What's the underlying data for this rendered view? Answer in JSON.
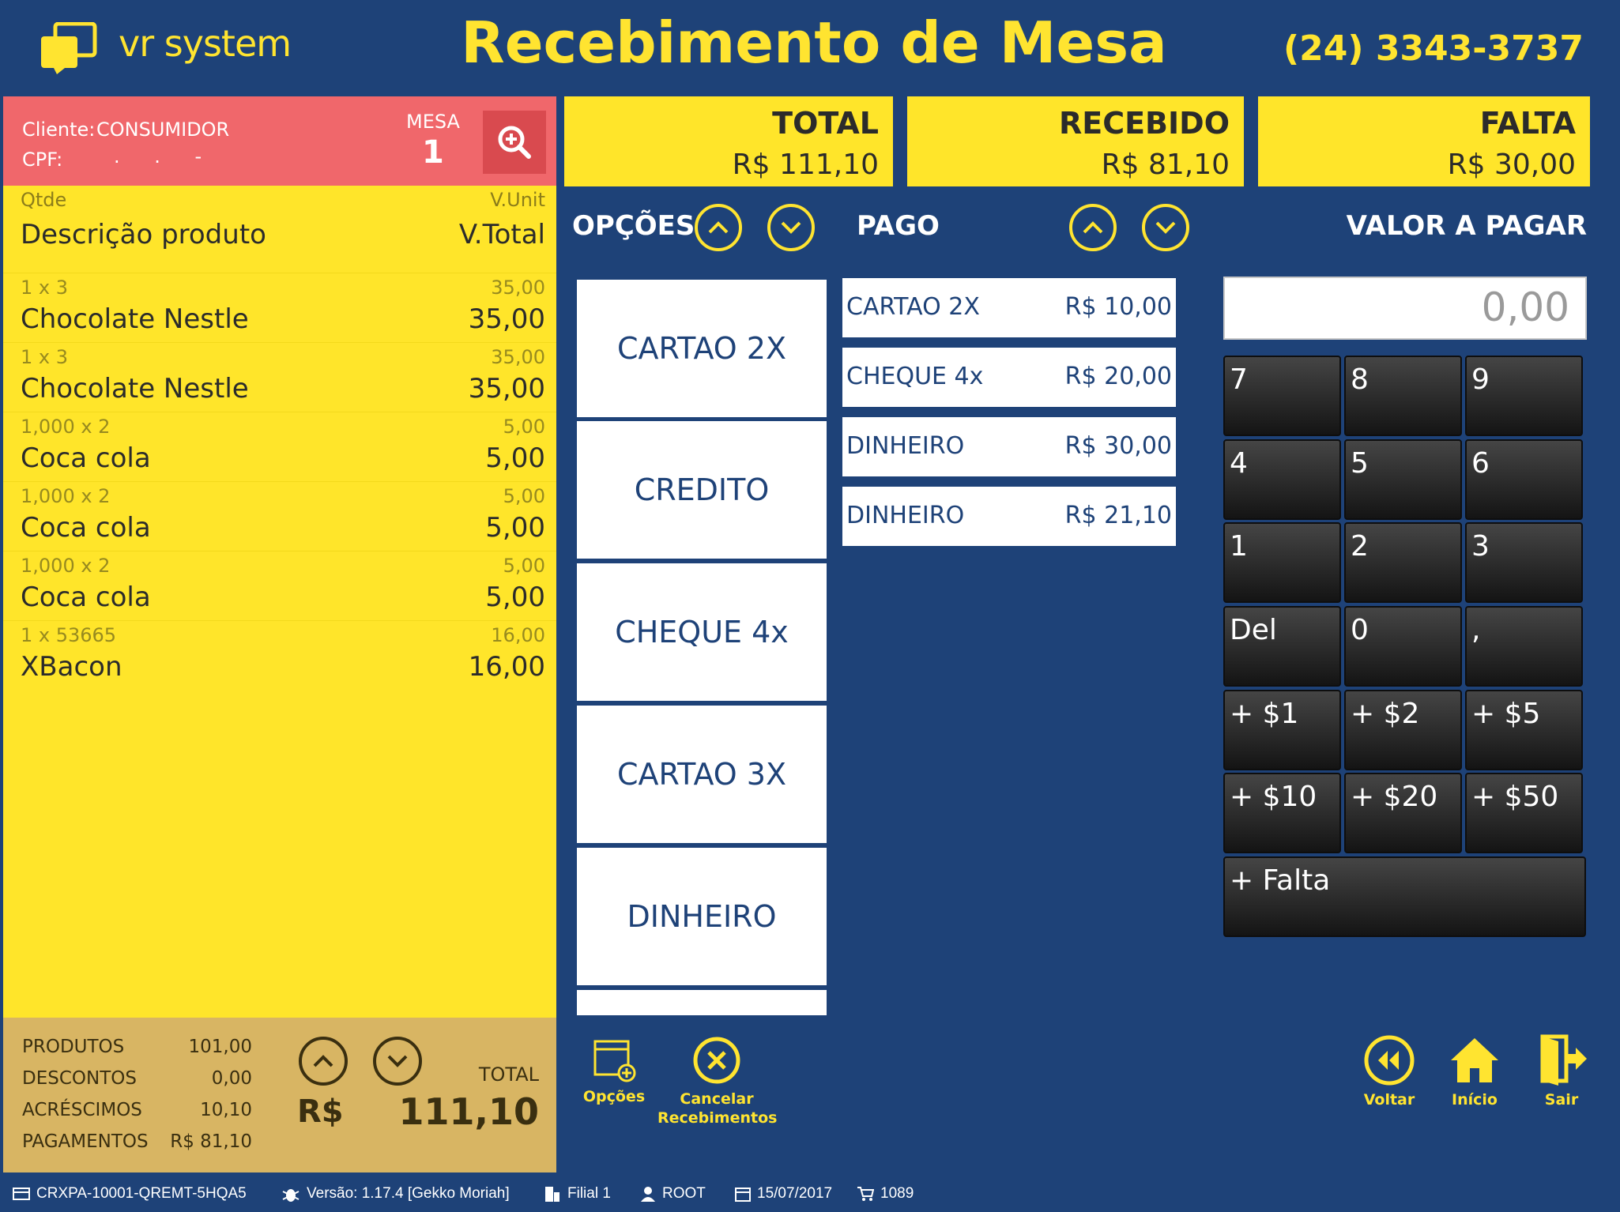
{
  "header": {
    "brand": "vr system",
    "title": "Recebimento de Mesa",
    "phone": "(24) 3343-3737"
  },
  "client": {
    "cliente_label": "Cliente:",
    "cliente_value": "CONSUMIDOR",
    "cpf_label": "CPF:",
    "cpf_value": ". . -",
    "mesa_label": "MESA",
    "mesa_value": "1"
  },
  "items_header": {
    "qty": "Qtde",
    "unit": "V.Unit",
    "desc": "Descrição produto",
    "total": "V.Total"
  },
  "items": [
    {
      "qty": "1 x 3",
      "unit": "35,00",
      "name": "Chocolate Nestle",
      "total": "35,00"
    },
    {
      "qty": "1 x 3",
      "unit": "35,00",
      "name": "Chocolate Nestle",
      "total": "35,00"
    },
    {
      "qty": "1,000 x 2",
      "unit": "5,00",
      "name": "Coca cola",
      "total": "5,00"
    },
    {
      "qty": "1,000 x 2",
      "unit": "5,00",
      "name": "Coca cola",
      "total": "5,00"
    },
    {
      "qty": "1,000 x 2",
      "unit": "5,00",
      "name": "Coca cola",
      "total": "5,00"
    },
    {
      "qty": "1 x 53665",
      "unit": "16,00",
      "name": "XBacon",
      "total": "16,00"
    }
  ],
  "summary": {
    "produtos_label": "PRODUTOS",
    "produtos": "101,00",
    "descontos_label": "DESCONTOS",
    "descontos": "0,00",
    "acrescimos_label": "ACRÉSCIMOS",
    "acrescimos": "10,10",
    "pagamentos_label": "PAGAMENTOS",
    "pagamentos": "R$ 81,10",
    "currency": "R$",
    "total_label": "TOTAL",
    "total": "111,10"
  },
  "totals": {
    "total_label": "TOTAL",
    "total_value": "R$ 111,10",
    "recebido_label": "RECEBIDO",
    "recebido_value": "R$ 81,10",
    "falta_label": "FALTA",
    "falta_value": "R$ 30,00"
  },
  "sections": {
    "opcoes": "OPÇÕES",
    "pago": "PAGO",
    "valor": "VALOR A PAGAR"
  },
  "options": [
    "CARTAO 2X",
    "CREDITO",
    "CHEQUE 4x",
    "CARTAO 3X",
    "DINHEIRO"
  ],
  "paid": [
    {
      "name": "CARTAO 2X",
      "value": "R$ 10,00"
    },
    {
      "name": "CHEQUE 4x",
      "value": "R$ 20,00"
    },
    {
      "name": "DINHEIRO",
      "value": "R$ 30,00"
    },
    {
      "name": "DINHEIRO",
      "value": "R$ 21,10"
    }
  ],
  "value_input": "0,00",
  "keypad": [
    [
      "7",
      "8",
      "9"
    ],
    [
      "4",
      "5",
      "6"
    ],
    [
      "1",
      "2",
      "3"
    ],
    [
      "Del",
      "0",
      ","
    ],
    [
      "+ $1",
      "+ $2",
      "+ $5"
    ],
    [
      "+ $10",
      "+ $20",
      "+ $50"
    ]
  ],
  "keypad_falta": "+ Falta",
  "actions": {
    "opcoes": "Opções",
    "cancelar": "Cancelar Recebimentos",
    "voltar": "Voltar",
    "inicio": "Início",
    "sair": "Sair"
  },
  "status": {
    "terminal": "CRXPA-10001-QREMT-5HQA5",
    "versao": "Versão: 1.17.4 [Gekko Moriah]",
    "filial": "Filial 1",
    "user": "ROOT",
    "date": "15/07/2017",
    "cart": "1089"
  },
  "colors": {
    "background": "#1e4278",
    "accent_yellow": "#ffe430",
    "client_bar": "#f0676b",
    "summary_bg": "#d8b563"
  }
}
